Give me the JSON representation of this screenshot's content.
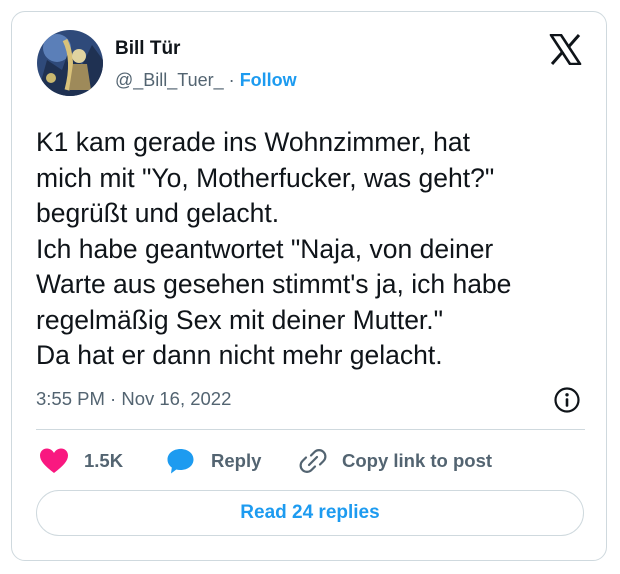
{
  "author": {
    "name": "Bill Tür",
    "handle": "@_Bill_Tuer_",
    "separator": "·",
    "follow_label": "Follow"
  },
  "tweet": {
    "text": "K1 kam gerade ins Wohnzimmer, hat\nmich mit \"Yo, Motherfucker, was geht?\"\nbegrüßt und gelacht.\nIch habe geantwortet \"Naja, von deiner\nWarte aus gesehen stimmt's ja, ich habe\nregelmäßig Sex mit deiner Mutter.\"\nDa hat er dann nicht mehr gelacht.",
    "timestamp": "3:55 PM · Nov 16, 2022"
  },
  "actions": {
    "like_count": "1.5K",
    "reply_label": "Reply",
    "copy_link_label": "Copy link to post"
  },
  "read_replies_label": "Read 24 replies",
  "icons": {
    "logo": "x-logo-icon",
    "info": "info-icon",
    "like": "heart-icon",
    "reply": "speech-bubble-icon",
    "copy": "link-icon"
  },
  "colors": {
    "accent": "#1d9bf0",
    "like": "#f91880",
    "secondary_text": "#536471",
    "border": "#cfd9de"
  }
}
